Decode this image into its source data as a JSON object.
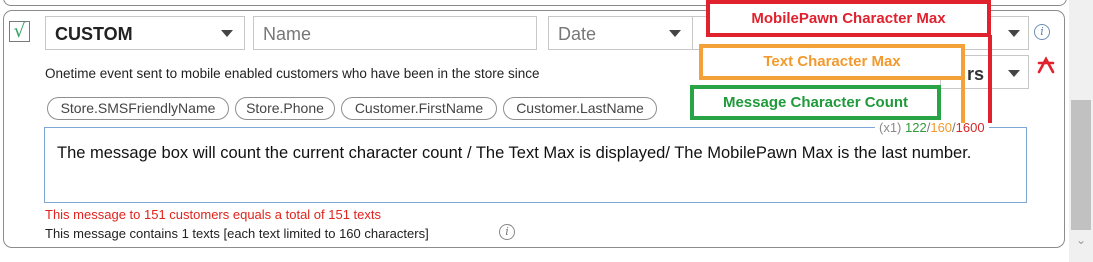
{
  "row": {
    "enabled": true,
    "checkmark": "√",
    "type_value": "CUSTOM",
    "name_placeholder": "Name",
    "date_placeholder": "Date",
    "secondary_value": "rs",
    "description": "Onetime event sent to mobile enabled customers who have been in the store since"
  },
  "tags": [
    "Store.SMSFriendlyName",
    "Store.Phone",
    "Customer.FirstName",
    "Customer.LastName"
  ],
  "message": {
    "text": "The message box will count the current character count / The Text Max is displayed/ The MobilePawn Max is the last number.",
    "multiplier": "(x1)",
    "char_count": "122",
    "text_max": "160",
    "mobilepawn_max": "1600",
    "separator": "/"
  },
  "summary": {
    "warning": "This message to 151 customers equals a total of 151 texts",
    "info": "This message contains 1 texts [each text limited to 160 characters]"
  },
  "annotations": {
    "mobilepawn_max": "MobilePawn Character Max",
    "text_max": "Text Character Max",
    "message_count": "Message Character Count"
  },
  "colors": {
    "mobilepawn_max": "#e0222e",
    "text_max": "#f29a2e",
    "message_count": "#2f9a3a",
    "warning": "#e0231c"
  },
  "icons": {
    "info": "info-icon",
    "remove": "remove-icon",
    "dropdown": "chevron-down-icon",
    "scroll_down": "scroll-down-arrow"
  }
}
